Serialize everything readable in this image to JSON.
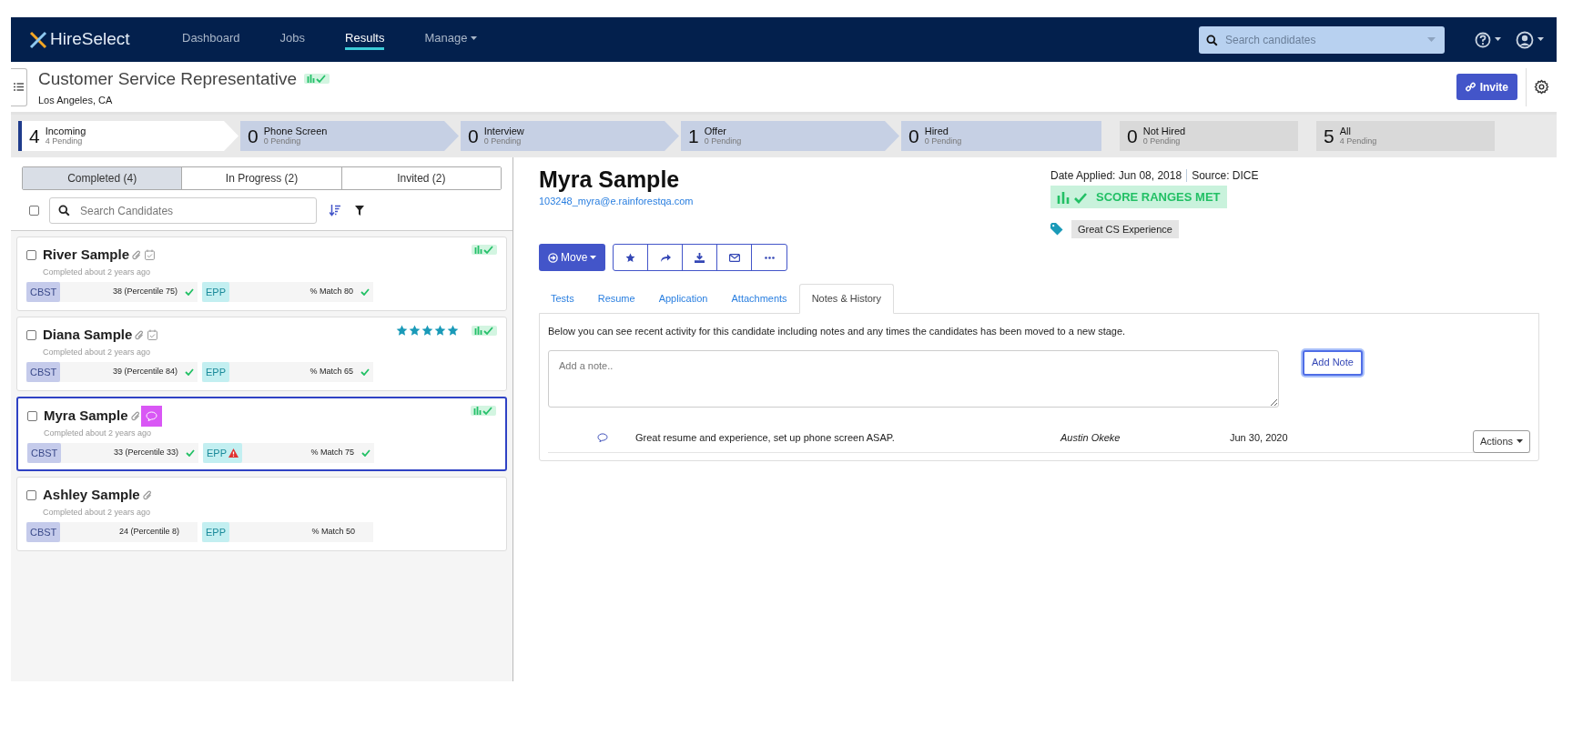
{
  "nav": {
    "logo": "HireSelect",
    "items": [
      {
        "label": "Dashboard",
        "selected": false,
        "dropdown": false
      },
      {
        "label": "Jobs",
        "selected": false,
        "dropdown": false
      },
      {
        "label": "Results",
        "selected": true,
        "dropdown": false
      },
      {
        "label": "Manage",
        "selected": false,
        "dropdown": true
      }
    ],
    "search": {
      "placeholder": "Search candidates"
    }
  },
  "job": {
    "title": "Customer Service Representative",
    "location": "Los Angeles, CA",
    "invite_button": "Invite"
  },
  "stages": [
    {
      "count": "4",
      "label": "Incoming",
      "sub": "4 Pending",
      "kind": "step",
      "selected": true
    },
    {
      "count": "0",
      "label": "Phone Screen",
      "sub": "0 Pending",
      "kind": "step",
      "selected": false
    },
    {
      "count": "0",
      "label": "Interview",
      "sub": "0 Pending",
      "kind": "step",
      "selected": false
    },
    {
      "count": "1",
      "label": "Offer",
      "sub": "0 Pending",
      "kind": "step",
      "selected": false
    },
    {
      "count": "0",
      "label": "Hired",
      "sub": "0 Pending",
      "kind": "end",
      "selected": false
    },
    {
      "count": "0",
      "label": "Not Hired",
      "sub": "0 Pending",
      "kind": "other",
      "selected": false
    },
    {
      "count": "5",
      "label": "All",
      "sub": "4 Pending",
      "kind": "other",
      "selected": false
    }
  ],
  "list": {
    "tabs": [
      {
        "label": "Completed (4)",
        "selected": true
      },
      {
        "label": "In Progress (2)",
        "selected": false
      },
      {
        "label": "Invited (2)",
        "selected": false
      }
    ],
    "select_all_checked": false,
    "search": {
      "placeholder": "Search Candidates"
    },
    "candidates": [
      {
        "name": "River Sample",
        "completed": "Completed about 2 years ago",
        "selected": false,
        "checked": false,
        "attachment": true,
        "scheduled": true,
        "comment": false,
        "score_met": true,
        "tests": [
          {
            "name": "CBST",
            "result": "38 (Percentile 75)",
            "passed": true,
            "warning": false
          },
          {
            "name": "EPP",
            "result": "% Match 80",
            "passed": true,
            "warning": false
          }
        ]
      },
      {
        "name": "Diana Sample",
        "completed": "Completed about 2 years ago",
        "selected": false,
        "checked": false,
        "attachment": true,
        "scheduled": true,
        "comment": false,
        "stars": 5,
        "score_met": true,
        "tests": [
          {
            "name": "CBST",
            "result": "39 (Percentile 84)",
            "passed": true,
            "warning": false
          },
          {
            "name": "EPP",
            "result": "% Match 65",
            "passed": true,
            "warning": false
          }
        ]
      },
      {
        "name": "Myra Sample",
        "completed": "Completed about 2 years ago",
        "selected": true,
        "checked": false,
        "attachment": true,
        "scheduled": false,
        "comment": true,
        "score_met": true,
        "tests": [
          {
            "name": "CBST",
            "result": "33 (Percentile 33)",
            "passed": true,
            "warning": false
          },
          {
            "name": "EPP",
            "result": "% Match 75",
            "passed": true,
            "warning": true
          }
        ]
      },
      {
        "name": "Ashley Sample",
        "completed": "Completed about 2 years ago",
        "selected": false,
        "checked": false,
        "attachment": true,
        "scheduled": false,
        "comment": false,
        "score_met": false,
        "tests": [
          {
            "name": "CBST",
            "result": "24 (Percentile 8)",
            "passed": false,
            "warning": false
          },
          {
            "name": "EPP",
            "result": "% Match 50",
            "passed": false,
            "warning": false
          }
        ]
      }
    ]
  },
  "detail": {
    "name": "Myra Sample",
    "email": "103248_myra@e.rainforestqa.com",
    "date_applied": "Date Applied: Jun 08, 2018",
    "source": "Source: DICE",
    "score_badge": "SCORE RANGES MET",
    "tag": "Great CS Experience",
    "move_button": "Move",
    "tabs": [
      {
        "label": "Tests",
        "selected": false
      },
      {
        "label": "Resume",
        "selected": false
      },
      {
        "label": "Application",
        "selected": false
      },
      {
        "label": "Attachments",
        "selected": false
      },
      {
        "label": "Notes & History",
        "selected": true
      }
    ],
    "description": "Below you can see recent activity for this candidate including notes and any times the candidates has been moved to a new stage.",
    "note_placeholder": "Add a note..",
    "add_note_button": "Add Note",
    "notes": [
      {
        "text": "Great resume and experience, set up phone screen ASAP.",
        "author": "Austin Okeke",
        "date": "Jun 30, 2020",
        "actions_button": "Actions"
      }
    ]
  }
}
